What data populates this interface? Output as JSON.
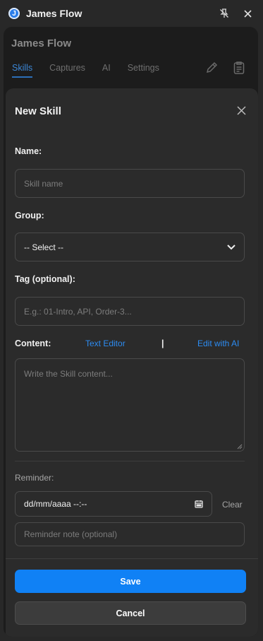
{
  "window": {
    "title": "James Flow",
    "logo_letter": "J"
  },
  "panel": {
    "title": "James Flow",
    "tabs": [
      {
        "label": "Skills",
        "active": true
      },
      {
        "label": "Captures",
        "active": false
      },
      {
        "label": "AI",
        "active": false
      },
      {
        "label": "Settings",
        "active": false
      }
    ]
  },
  "modal": {
    "title": "New Skill",
    "name_label": "Name:",
    "name_placeholder": "Skill name",
    "group_label": "Group:",
    "group_value": "-- Select --",
    "tag_label": "Tag (optional):",
    "tag_placeholder": "E.g.: 01-Intro, API, Order-3...",
    "content_label": "Content:",
    "text_editor_link": "Text Editor",
    "divider_char": "|",
    "edit_ai_link": "Edit with AI",
    "content_placeholder": "Write the Skill content...",
    "reminder_label": "Reminder:",
    "date_value": "dd/mm/aaaa  --:--",
    "clear_label": "Clear",
    "note_placeholder": "Reminder note (optional)",
    "save_label": "Save",
    "cancel_label": "Cancel"
  },
  "colors": {
    "accent": "#1081f5",
    "link": "#2c8cf2",
    "tab_active": "#3c87d6"
  },
  "icons": [
    "pin-off-icon",
    "close-icon",
    "pencil-icon",
    "clipboard-icon",
    "chevron-down-icon",
    "calendar-icon"
  ]
}
